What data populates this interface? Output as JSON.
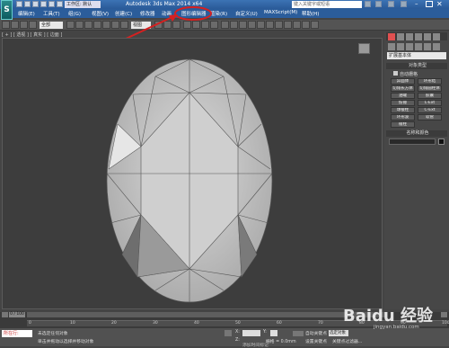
{
  "app": {
    "title": "Autodesk 3ds Max 2014 x64",
    "workspace": "工作区: 默认",
    "search_placeholder": "键入关键字或短语"
  },
  "menus": [
    "编辑(E)",
    "工具(T)",
    "组(G)",
    "视图(V)",
    "创建(C)",
    "修改器",
    "动画",
    "图形编辑器",
    "渲染(R)",
    "自定义(U)",
    "MAXScript(M)",
    "帮助(H)"
  ],
  "toolbar": {
    "selection_filter": "全部",
    "reference_coord": "视图"
  },
  "viewport": {
    "label": "[ + ] [ 透视 ] [ 真实 ] [ 边面 ]"
  },
  "command_panel": {
    "category": "扩展基本体",
    "object_type_header": "对象类型",
    "autogrid_label": "自动栅格",
    "buttons": [
      "异面体",
      "环形结",
      "切角长方体",
      "切角圆柱体",
      "油罐",
      "胶囊",
      "纺锤",
      "L-Ext",
      "球棱柱",
      "C-Ext",
      "环形波",
      "软管",
      "棱柱"
    ],
    "name_color_header": "名称和颜色"
  },
  "timeline": {
    "frame_display": "0 / 100",
    "ticks": [
      "0",
      "10",
      "20",
      "30",
      "40",
      "50",
      "60",
      "70",
      "80",
      "90",
      "100"
    ]
  },
  "status": {
    "mode_button": "所在行:",
    "line1": "未选定任何对象",
    "line2": "单击并拖动以选择并移动对象",
    "grid_label": "栅格 = 0.0mm",
    "autokey_label": "自动关键点",
    "selected_dropdown": "选定对象",
    "setkey_label": "设置关键点",
    "keyfilter_label": "关键点过滤器...",
    "add_time_tag": "添加时间标记",
    "x_value": "X:",
    "y_value": "Y:",
    "z_value": "Z:"
  },
  "watermark": {
    "brand": "Baidu 经验",
    "url": "jingyan.baidu.com"
  },
  "colors": {
    "title_blue": "#2b5d9b",
    "annotation_red": "#d62020",
    "viewport_bg": "#3d3d3d",
    "gem_face": "#cfcfcf"
  }
}
